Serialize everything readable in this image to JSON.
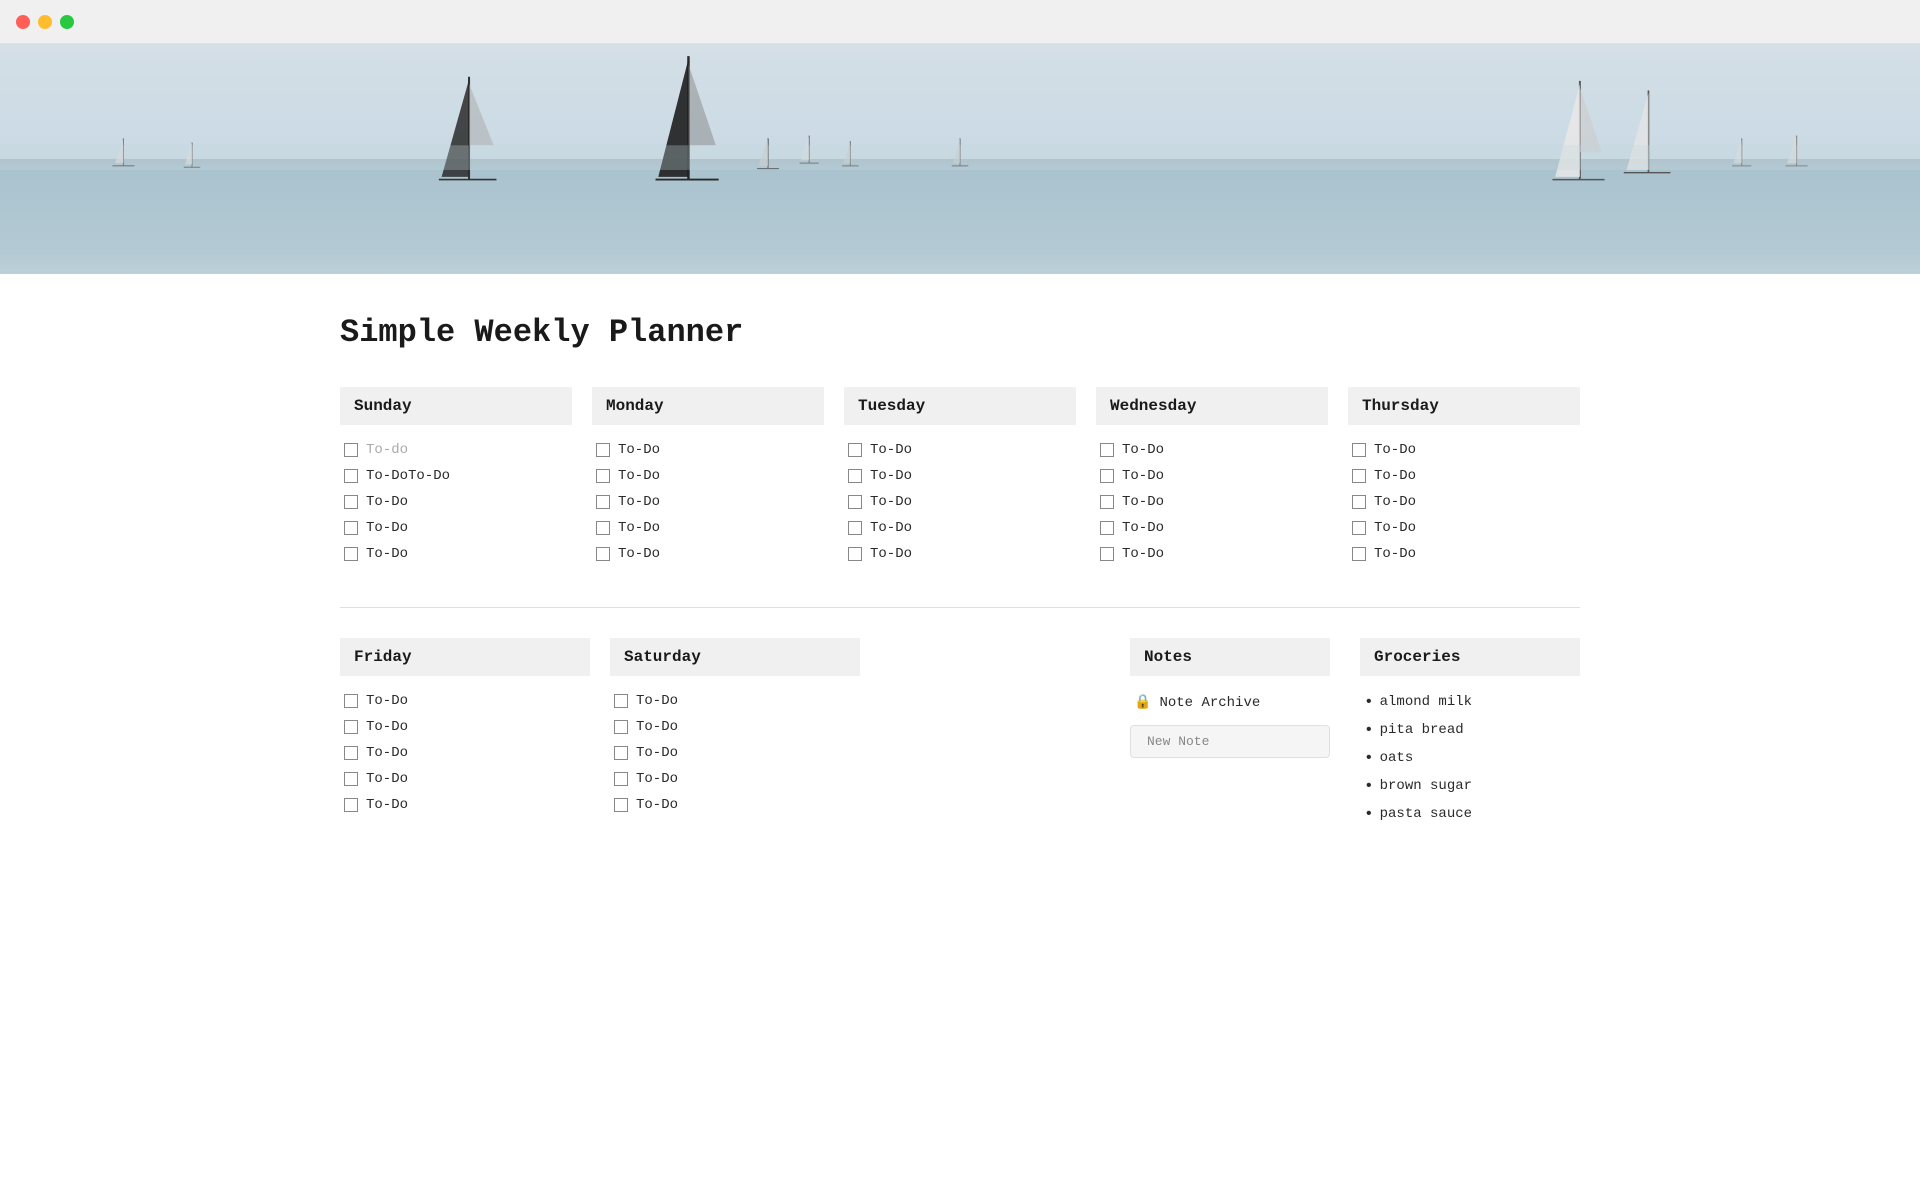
{
  "window": {
    "title": "Simple Weekly Planner"
  },
  "traffic_lights": {
    "close": "close",
    "minimize": "minimize",
    "maximize": "maximize"
  },
  "page_title": "Simple Weekly Planner",
  "days_top": [
    {
      "name": "Sunday",
      "items": [
        {
          "label": "To-do",
          "placeholder": true
        },
        {
          "label": "To-DoTo-Do",
          "placeholder": false
        },
        {
          "label": "To-Do",
          "placeholder": false
        },
        {
          "label": "To-Do",
          "placeholder": false
        },
        {
          "label": "To-Do",
          "placeholder": false
        }
      ]
    },
    {
      "name": "Monday",
      "items": [
        {
          "label": "To-Do",
          "placeholder": false
        },
        {
          "label": "To-Do",
          "placeholder": false
        },
        {
          "label": "To-Do",
          "placeholder": false
        },
        {
          "label": "To-Do",
          "placeholder": false
        },
        {
          "label": "To-Do",
          "placeholder": false
        }
      ]
    },
    {
      "name": "Tuesday",
      "items": [
        {
          "label": "To-Do",
          "placeholder": false
        },
        {
          "label": "To-Do",
          "placeholder": false
        },
        {
          "label": "To-Do",
          "placeholder": false
        },
        {
          "label": "To-Do",
          "placeholder": false
        },
        {
          "label": "To-Do",
          "placeholder": false
        }
      ]
    },
    {
      "name": "Wednesday",
      "items": [
        {
          "label": "To-Do",
          "placeholder": false
        },
        {
          "label": "To-Do",
          "placeholder": false
        },
        {
          "label": "To-Do",
          "placeholder": false
        },
        {
          "label": "To-Do",
          "placeholder": false
        },
        {
          "label": "To-Do",
          "placeholder": false
        }
      ]
    },
    {
      "name": "Thursday",
      "items": [
        {
          "label": "To-Do",
          "placeholder": false
        },
        {
          "label": "To-Do",
          "placeholder": false
        },
        {
          "label": "To-Do",
          "placeholder": false
        },
        {
          "label": "To-Do",
          "placeholder": false
        },
        {
          "label": "To-Do",
          "placeholder": false
        }
      ]
    }
  ],
  "days_bottom": [
    {
      "name": "Friday",
      "items": [
        {
          "label": "To-Do",
          "placeholder": false
        },
        {
          "label": "To-Do",
          "placeholder": false
        },
        {
          "label": "To-Do",
          "placeholder": false
        },
        {
          "label": "To-Do",
          "placeholder": false
        },
        {
          "label": "To-Do",
          "placeholder": false
        }
      ]
    },
    {
      "name": "Saturday",
      "items": [
        {
          "label": "To-Do",
          "placeholder": false
        },
        {
          "label": "To-Do",
          "placeholder": false
        },
        {
          "label": "To-Do",
          "placeholder": false
        },
        {
          "label": "To-Do",
          "placeholder": false
        },
        {
          "label": "To-Do",
          "placeholder": false
        }
      ]
    }
  ],
  "notes": {
    "header": "Notes",
    "archive_label": "Note Archive",
    "new_note_placeholder": "New Note"
  },
  "groceries": {
    "header": "Groceries",
    "items": [
      "almond milk",
      "pita bread",
      "oats",
      "brown sugar",
      "pasta sauce"
    ]
  }
}
